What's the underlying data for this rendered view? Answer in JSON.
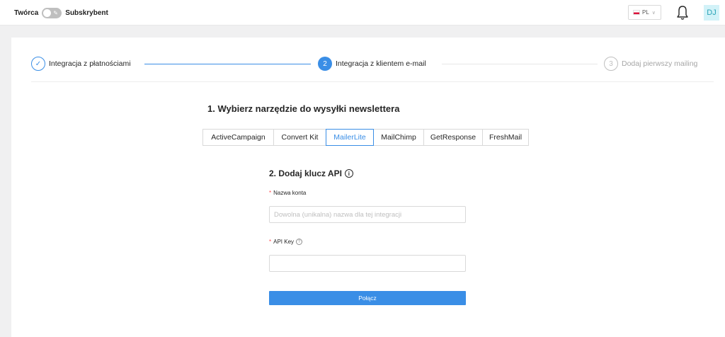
{
  "header": {
    "role_left": "Twórca",
    "role_right": "Subskrybent",
    "language": "PL",
    "avatar_initials": "DJ",
    "icons": {
      "bell": "bell-icon",
      "flag": "poland-flag-icon",
      "chevron": "chevron-down-icon"
    }
  },
  "steps": [
    {
      "number": "1",
      "label": "Integracja z płatnościami",
      "status": "done"
    },
    {
      "number": "2",
      "label": "Integracja z klientem e-mail",
      "status": "active"
    },
    {
      "number": "3",
      "label": "Dodaj pierwszy mailing",
      "status": "todo"
    }
  ],
  "section1": {
    "title": "1. Wybierz narzędzie do wysyłki newslettera",
    "tools": [
      "ActiveCampaign",
      "Convert Kit",
      "MailerLite",
      "MailChimp",
      "GetResponse",
      "FreshMail"
    ],
    "selected": "MailerLite"
  },
  "section2": {
    "title": "2. Dodaj klucz API",
    "account_label": "Nazwa konta",
    "account_value": "",
    "account_placeholder": "Dowolna (unikalna) nazwa dla tej integracji",
    "api_label": "API Key",
    "api_value": "",
    "submit_label": "Połącz"
  },
  "colors": {
    "accent": "#3a8ee6",
    "required": "#ff4d4f",
    "avatar_bg": "#d2f2f8",
    "avatar_fg": "#2aa3b7"
  }
}
